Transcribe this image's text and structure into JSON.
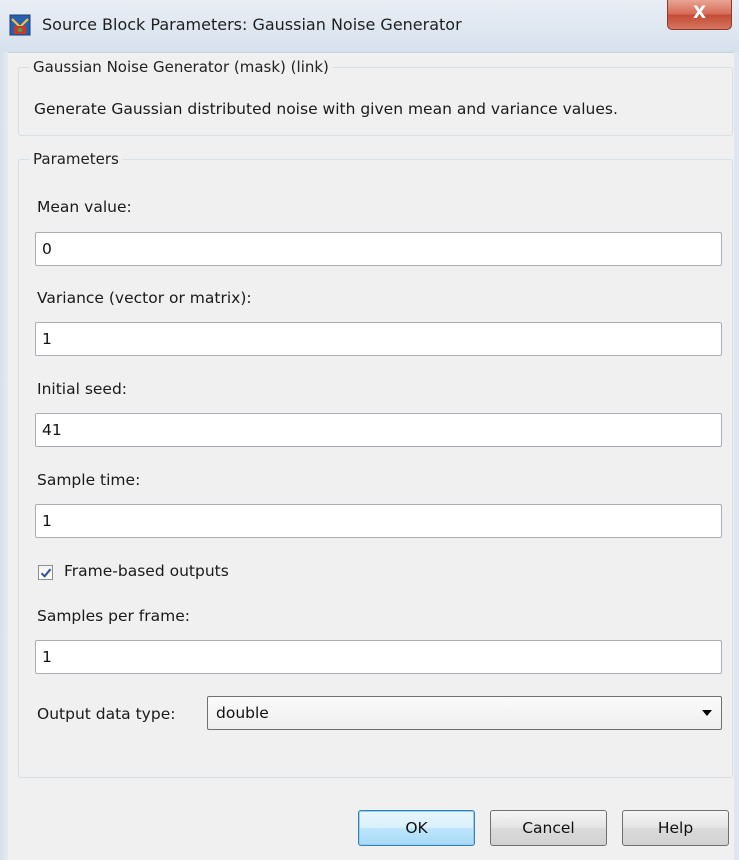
{
  "window": {
    "title": "Source Block Parameters: Gaussian Noise Generator",
    "close_glyph": "X"
  },
  "description_group": {
    "legend": "Gaussian Noise Generator (mask) (link)",
    "text": "Generate Gaussian distributed noise with given mean and variance values."
  },
  "parameters": {
    "legend": "Parameters",
    "mean_label": "Mean value:",
    "mean_value": "0",
    "variance_label": "Variance (vector or matrix):",
    "variance_value": "1",
    "seed_label": "Initial seed:",
    "seed_value": "41",
    "sample_time_label": "Sample time:",
    "sample_time_value": "1",
    "frame_based_label": "Frame-based outputs",
    "frame_based_checked": true,
    "samples_per_frame_label": "Samples per frame:",
    "samples_per_frame_value": "1",
    "output_type_label": "Output data type:",
    "output_type_value": "double"
  },
  "buttons": {
    "ok": "OK",
    "cancel": "Cancel",
    "help": "Help"
  },
  "icons": {
    "app": "simulink-block-icon",
    "close": "close-icon",
    "check": "check-icon",
    "dropdown": "chevron-down-icon"
  },
  "colors": {
    "dialog_bg": "#f0f0f0",
    "close_button": "#c44b35",
    "default_button_border": "#3c7fb1",
    "checkbox_check": "#2b4fa0"
  }
}
